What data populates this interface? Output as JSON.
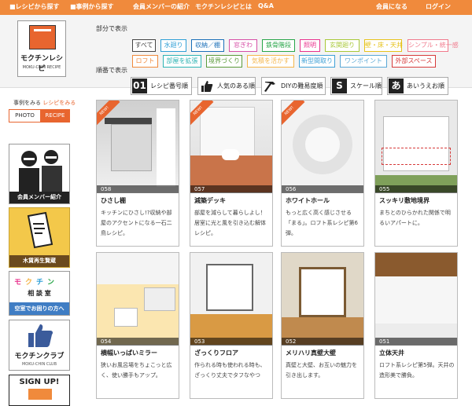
{
  "topbar": {
    "links": [
      "■レシピから探す",
      "■事例から探す",
      "会員メンバーの紹介",
      "モクチンレシピとは",
      "Q&A"
    ],
    "member_button": "会員になる",
    "login_button": "ログイン"
  },
  "logo": {
    "title": "モクチンレシピ",
    "subtitle": "MOKU-CHIN RECIPE"
  },
  "filter": {
    "label": "部分で表示",
    "chips": [
      {
        "label": "すべて",
        "color": "#444444"
      },
      {
        "label": "水廻り",
        "color": "#2e9fd6"
      },
      {
        "label": "収納／棚",
        "color": "#1a6fb8"
      },
      {
        "label": "窓ぎわ",
        "color": "#d64fa6"
      },
      {
        "label": "鉄骨階段",
        "color": "#27a548"
      },
      {
        "label": "照明",
        "color": "#e8308c"
      },
      {
        "label": "玄関廻り",
        "color": "#a8c837"
      },
      {
        "label": "壁・床・天井",
        "color": "#e6c21a"
      },
      {
        "label": "シンプル・統一感",
        "color": "#f07a8c"
      },
      {
        "label": "ロフト",
        "color": "#f08a3c"
      },
      {
        "label": "部屋を拡張",
        "color": "#2db3b3"
      },
      {
        "label": "境界づくり",
        "color": "#5a9a3a"
      },
      {
        "label": "気積を活かす",
        "color": "#f4b54a"
      },
      {
        "label": "新型間取り",
        "color": "#3fa0d6"
      },
      {
        "label": "ワンポイント",
        "color": "#5aa8d6"
      },
      {
        "label": "外部スペース",
        "color": "#d63a3a"
      }
    ]
  },
  "sort": {
    "label": "順番で表示",
    "buttons": [
      {
        "icon": "01",
        "label": "レシピ番号順"
      },
      {
        "icon": "thumbs-up-icon",
        "label": "人気のある順"
      },
      {
        "icon": "hammer-icon",
        "label": "DIYの難易度順"
      },
      {
        "icon": "S",
        "label": "スケール順"
      },
      {
        "icon": "あ",
        "label": "あいうえお順"
      }
    ]
  },
  "sidebar": {
    "view_text": "事例をみる",
    "recipe_text": "レシピをみる",
    "toggle_photo": "PHOTO",
    "toggle_recipe": "RECIPE",
    "members_caption": "会員メンバー紹介",
    "wood_caption": "木賃再生賢蔵",
    "consult": {
      "chars": [
        "モ",
        "ク",
        "チ",
        "ン"
      ],
      "sub": "相 談 室",
      "caption": "空室でお困りの方へ"
    },
    "club": {
      "title": "モクチンクラブ",
      "sub": "MOKU-CHIN CLUB"
    },
    "signup": "SIGN UP!"
  },
  "cards": [
    {
      "num": "058",
      "title": "ひさし棚",
      "desc": "キッチンにひさし!?収納や部屋のアクセントになる一石二鳥レシピ。",
      "new": "NEW!"
    },
    {
      "num": "057",
      "title": "減築デッキ",
      "desc": "部屋を減らして暮らしよし！居室に光と風を引き込む解体レシピ。",
      "new": "NEW!"
    },
    {
      "num": "056",
      "title": "ホワイトホール",
      "desc": "もっと広く高く感じさせる「まる」。ロフト系レシピ第6弾。",
      "new": "NEW!"
    },
    {
      "num": "055",
      "title": "スッキリ敷地境界",
      "desc": "まちとのひらかれた関係で明るいアパートに。",
      "new": ""
    },
    {
      "num": "054",
      "title": "横幅いっぱいミラー",
      "desc": "狭いお風呂場をちょこっと広く、使い勝手もアップ。",
      "new": ""
    },
    {
      "num": "053",
      "title": "ざっくりフロア",
      "desc": "作られる時も使われる時も、ざっくり丈夫でタフなやつ",
      "new": ""
    },
    {
      "num": "052",
      "title": "メリハリ真壁大壁",
      "desc": "真壁と大壁、お互いの魅力を引き出します。",
      "new": ""
    },
    {
      "num": "051",
      "title": "立体天井",
      "desc": "ロフト系レシピ第5弾。天井の造形美で勝負。",
      "new": ""
    }
  ]
}
